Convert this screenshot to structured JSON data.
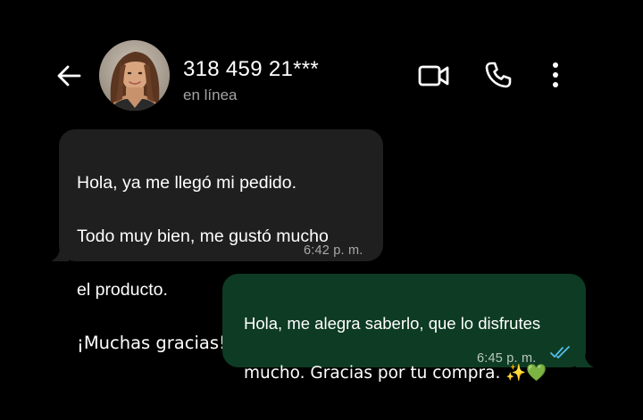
{
  "header": {
    "back_label": "back",
    "contact_name": "318 459 21***",
    "status": "en línea",
    "colors": {
      "background": "#000000",
      "status_text": "#a4a4a4"
    }
  },
  "messages": {
    "incoming": {
      "lines": [
        "Hola, ya me llegó mi pedido.",
        "Todo muy bien, me gustó mucho",
        "el producto.",
        "¡Muchas gracias! 😊"
      ],
      "time": "6:42 p. m.",
      "bubble_color": "#1f1f1f"
    },
    "outgoing": {
      "lines": [
        "Hola, me alegra saberlo, que lo disfrutes",
        "mucho. Gracias por tu compra. ✨💚"
      ],
      "time": "6:45 p. m.",
      "status": "read",
      "bubble_color": "#0e3b23",
      "tick_color": "#53bdeb"
    }
  }
}
